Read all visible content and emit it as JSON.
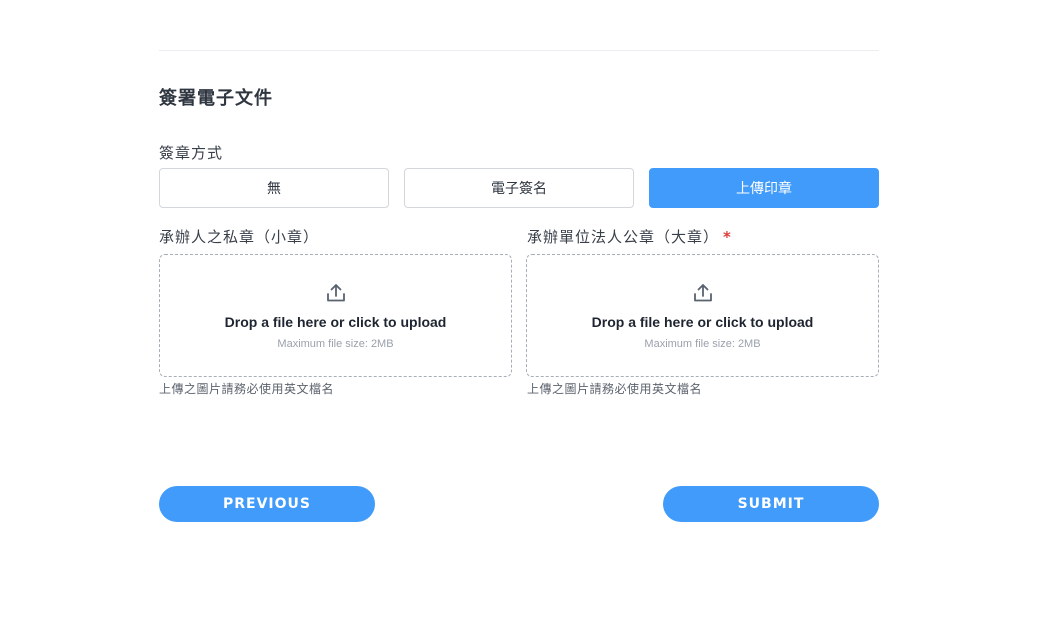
{
  "section": {
    "title": "簽署電子文件"
  },
  "method": {
    "label": "簽章方式",
    "options": [
      "無",
      "電子簽名",
      "上傳印章"
    ],
    "selected": "上傳印章"
  },
  "uploads": [
    {
      "label": "承辦人之私章（小章）",
      "required": false,
      "icon": "upload-icon",
      "prompt": "Drop a file here or click to upload",
      "max_size": "Maximum file size: 2MB",
      "hint": "上傳之圖片請務必使用英文檔名"
    },
    {
      "label": "承辦單位法人公章（大章）",
      "required": true,
      "required_mark": "*",
      "icon": "upload-icon",
      "prompt": "Drop a file here or click to upload",
      "max_size": "Maximum file size: 2MB",
      "hint": "上傳之圖片請務必使用英文檔名"
    }
  ],
  "nav": {
    "previous_label": "PREVIOUS",
    "submit_label": "SUBMIT"
  },
  "colors": {
    "accent": "#419bfa",
    "required": "#e03b3b"
  }
}
